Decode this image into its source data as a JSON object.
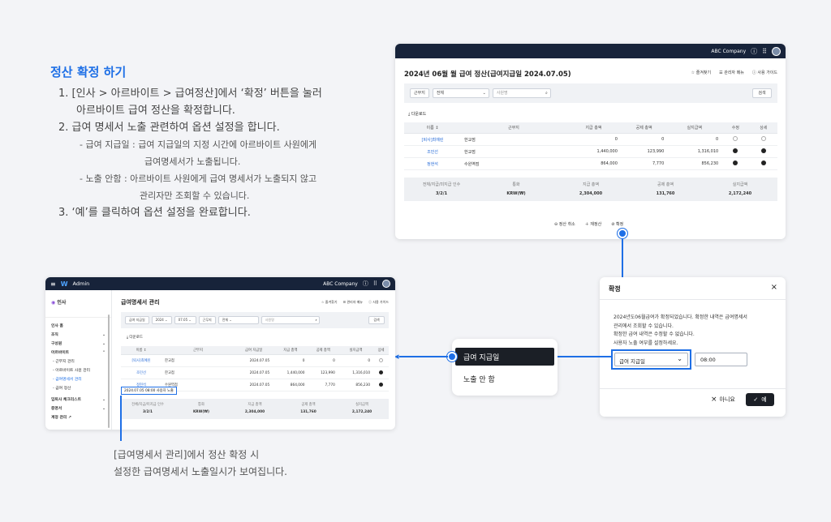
{
  "instructions": {
    "heading": "정산 확정 하기",
    "step1a": "1. [인사 > 아르바이트 > 급여정산]에서 ‘확정’ 버튼을 눌러",
    "step1b": "아르바이트 급여 정산을 확정합니다.",
    "step2": "2. 급여 명세서 노출 관련하여 옵션 설정을 합니다.",
    "sub1a": "- 급여 지급일 : 급여 지급일의 지정 시간에 아르바이트 사원에게",
    "sub1b": "급여명세서가 노출됩니다.",
    "sub2a": "- 노출 안함 : 아르바이트 사원에게 급여 명세서가 노출되지 않고",
    "sub2b": "관리자만 조회할 수 있습니다.",
    "step3": "3. ‘예’를 클릭하여 옵션 설정을 완료합니다."
  },
  "settlement": {
    "company": "ABC Company",
    "title": "2024년 06월 월 급여 정산(급여지급일 2024.07.05)",
    "favorites": "즐겨찾기",
    "admin_menu": "관리자 메뉴",
    "guide": "사용 가이드",
    "filter_label": "근무지",
    "filter_value": "전체",
    "name_placeholder": "사원명",
    "search_btn": "검색",
    "download": "다운로드",
    "headers": [
      "이름 ↕",
      "근무지",
      "지급 총액",
      "공제 총액",
      "실지급액",
      "수정",
      "상세"
    ],
    "rows": [
      {
        "name": "[퇴사]최예린",
        "place": "한교점",
        "pay": "0",
        "deduct": "0",
        "net": "0"
      },
      {
        "name": "조민선",
        "place": "한교점",
        "pay": "1,440,000",
        "deduct": "123,990",
        "net": "1,316,010"
      },
      {
        "name": "정현석",
        "place": "수원역점",
        "pay": "864,000",
        "deduct": "7,770",
        "net": "856,230"
      }
    ],
    "sum_headers": [
      "전체/지급/미지급 인수",
      "통화",
      "지급 총액",
      "공제 총액",
      "실지급액"
    ],
    "sum_values": [
      "3/2/1",
      "KRW(₩)",
      "2,304,000",
      "131,760",
      "2,172,240"
    ],
    "cancel": "정산 취소",
    "recalc": "재정산",
    "confirm": "확정"
  },
  "dialog": {
    "title": "확정",
    "line1": "2024년도06월급여가 확정되었습니다. 확정한 내역은 급여명세서",
    "line2": "관리에서 조회할 수 있습니다.",
    "line3": "확정한 급여 내역은 수정할 수 없습니다.",
    "line4": "사용자 노출 여부를 설정하세요.",
    "select_value": "급여 지급일",
    "time_value": "08:00",
    "no": "아니요",
    "yes": "예"
  },
  "dropdown": {
    "option1": "급여 지급일",
    "option2": "노출 안 함"
  },
  "admin": {
    "brand": "Admin",
    "company": "ABC Company",
    "section": "인사",
    "title": "급여명세서 관리",
    "favorites": "즐겨찾기",
    "admin_menu": "관리자 메뉴",
    "guide": "사용 가이드",
    "nav": [
      "인사 홈",
      "조직",
      "구성원",
      "아르바이트",
      "- 근무지 관리",
      "- 아르바이트 사원 관리",
      "- 급여명세서 관리",
      "- 급여 정산",
      "입퇴사 체크리스트",
      "증명서",
      "계정 관리 ↗"
    ],
    "f1": "급여 지급일",
    "f2": "2024",
    "f3": "07.05",
    "f4": "근무지",
    "f5": "전체",
    "name_placeholder": "사원명",
    "search_btn": "검색",
    "download": "다운로드",
    "headers": [
      "이름 ↕",
      "근무지",
      "급여 지급일",
      "지급 총액",
      "공제 총액",
      "실지급액",
      "상세"
    ],
    "rows": [
      {
        "name": "[퇴사]최예린",
        "place": "한교점",
        "date": "2024.07.05",
        "pay": "0",
        "deduct": "0",
        "net": "0"
      },
      {
        "name": "조민선",
        "place": "한교점",
        "date": "2024.07.05",
        "pay": "1,440,000",
        "deduct": "123,990",
        "net": "1,316,010"
      },
      {
        "name": "정현석",
        "place": "수원역점",
        "date": "2024.07.05",
        "pay": "864,000",
        "deduct": "7,770",
        "net": "856,230"
      }
    ],
    "exposure_note": "2024.07.05 08:00 사용자 노출",
    "sum_headers": [
      "전체/지급/미지급 인수",
      "통화",
      "지급 총액",
      "공제 총액",
      "실지급액"
    ],
    "sum_values": [
      "3/2/1",
      "KRW(₩)",
      "2,304,000",
      "131,760",
      "2,172,240"
    ]
  },
  "caption": {
    "line1": "[급여명세서 관리]에서 정산 확정 시",
    "line2": "설정한 급여명세서 노출일시가 보여집니다."
  },
  "colors": {
    "accent": "#1e6fe6",
    "topbar": "#17233a",
    "background": "#f3f4f7"
  }
}
